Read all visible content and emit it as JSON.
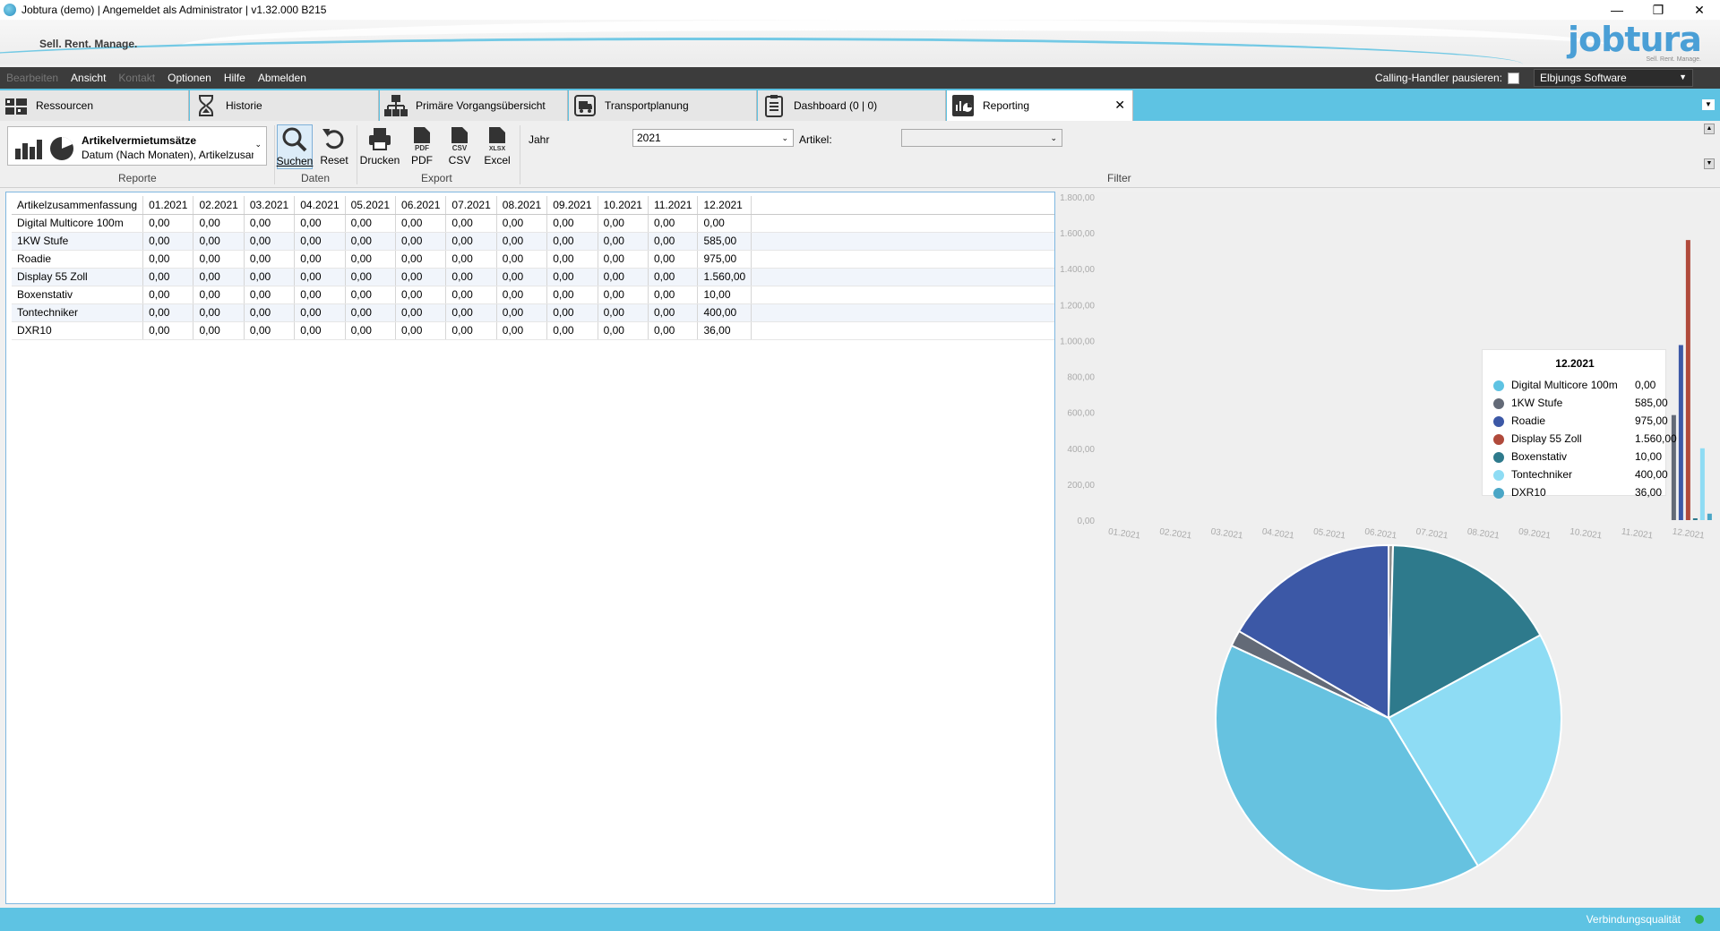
{
  "window": {
    "title": "Jobtura (demo) | Angemeldet als Administrator | v1.32.000 B215",
    "minimize": "—",
    "restore": "❐",
    "close": "✕"
  },
  "banner": {
    "tagline": "Sell. Rent. Manage.",
    "logo": "jobtura",
    "logo_sub": "Sell. Rent. Manage."
  },
  "menu": {
    "items": [
      "Bearbeiten",
      "Ansicht",
      "Kontakt",
      "Optionen",
      "Hilfe",
      "Abmelden"
    ],
    "disabled": [
      true,
      false,
      true,
      false,
      false,
      false
    ],
    "calling_handler_label": "Calling-Handler pausieren:",
    "company": "Elbjungs Software"
  },
  "tabs": [
    {
      "label": "Ressourcen",
      "icon": "resources-icon"
    },
    {
      "label": "Historie",
      "icon": "hourglass-icon"
    },
    {
      "label": "Primäre Vorgangsübersicht",
      "icon": "hierarchy-icon"
    },
    {
      "label": "Transportplanung",
      "icon": "truck-icon"
    },
    {
      "label": "Dashboard (0 | 0)",
      "icon": "clipboard-icon"
    },
    {
      "label": "Reporting",
      "icon": "reporting-icon",
      "active": true,
      "close": "✕"
    }
  ],
  "ribbon": {
    "report_title": "Artikelvermietumsätze",
    "report_sub": "Datum (Nach Monaten), Artikelzusammenfassung",
    "search": "Suchen",
    "reset": "Reset",
    "print": "Drucken",
    "pdf": "PDF",
    "csv": "CSV",
    "excel": "Excel",
    "group_reports": "Reporte",
    "group_data": "Daten",
    "group_export": "Export",
    "group_filter": "Filter",
    "year_label": "Jahr",
    "year_value": "2021",
    "article_label": "Artikel:",
    "article_value": ""
  },
  "table": {
    "headers": [
      "Artikelzusammenfassung",
      "01.2021",
      "02.2021",
      "03.2021",
      "04.2021",
      "05.2021",
      "06.2021",
      "07.2021",
      "08.2021",
      "09.2021",
      "10.2021",
      "11.2021",
      "12.2021"
    ],
    "rows": [
      [
        "Digital Multicore 100m",
        "0,00",
        "0,00",
        "0,00",
        "0,00",
        "0,00",
        "0,00",
        "0,00",
        "0,00",
        "0,00",
        "0,00",
        "0,00",
        "0,00"
      ],
      [
        "1KW Stufe",
        "0,00",
        "0,00",
        "0,00",
        "0,00",
        "0,00",
        "0,00",
        "0,00",
        "0,00",
        "0,00",
        "0,00",
        "0,00",
        "585,00"
      ],
      [
        "Roadie",
        "0,00",
        "0,00",
        "0,00",
        "0,00",
        "0,00",
        "0,00",
        "0,00",
        "0,00",
        "0,00",
        "0,00",
        "0,00",
        "975,00"
      ],
      [
        "Display 55 Zoll",
        "0,00",
        "0,00",
        "0,00",
        "0,00",
        "0,00",
        "0,00",
        "0,00",
        "0,00",
        "0,00",
        "0,00",
        "0,00",
        "1.560,00"
      ],
      [
        "Boxenstativ",
        "0,00",
        "0,00",
        "0,00",
        "0,00",
        "0,00",
        "0,00",
        "0,00",
        "0,00",
        "0,00",
        "0,00",
        "0,00",
        "10,00"
      ],
      [
        "Tontechniker",
        "0,00",
        "0,00",
        "0,00",
        "0,00",
        "0,00",
        "0,00",
        "0,00",
        "0,00",
        "0,00",
        "0,00",
        "0,00",
        "400,00"
      ],
      [
        "DXR10",
        "0,00",
        "0,00",
        "0,00",
        "0,00",
        "0,00",
        "0,00",
        "0,00",
        "0,00",
        "0,00",
        "0,00",
        "0,00",
        "36,00"
      ]
    ]
  },
  "tooltip": {
    "title": "12.2021",
    "rows": [
      {
        "name": "Digital Multicore 100m",
        "value": "0,00"
      },
      {
        "name": "1KW Stufe",
        "value": "585,00"
      },
      {
        "name": "Roadie",
        "value": "975,00"
      },
      {
        "name": "Display 55 Zoll",
        "value": "1.560,00"
      },
      {
        "name": "Boxenstativ",
        "value": "10,00"
      },
      {
        "name": "Tontechniker",
        "value": "400,00"
      },
      {
        "name": "DXR10",
        "value": "36,00"
      }
    ]
  },
  "chart_data": [
    {
      "type": "bar",
      "categories": [
        "01.2021",
        "02.2021",
        "03.2021",
        "04.2021",
        "05.2021",
        "06.2021",
        "07.2021",
        "08.2021",
        "09.2021",
        "10.2021",
        "11.2021",
        "12.2021"
      ],
      "y_ticks": [
        "0,00",
        "200,00",
        "400,00",
        "600,00",
        "800,00",
        "1.000,00",
        "1.200,00",
        "1.400,00",
        "1.600,00",
        "1.800,00"
      ],
      "ylim": [
        0,
        1800
      ],
      "series": [
        {
          "name": "Digital Multicore 100m",
          "color": "#5ec3e3",
          "values": [
            0,
            0,
            0,
            0,
            0,
            0,
            0,
            0,
            0,
            0,
            0,
            0
          ]
        },
        {
          "name": "1KW Stufe",
          "color": "#636a77",
          "values": [
            0,
            0,
            0,
            0,
            0,
            0,
            0,
            0,
            0,
            0,
            0,
            585
          ]
        },
        {
          "name": "Roadie",
          "color": "#3c58a6",
          "values": [
            0,
            0,
            0,
            0,
            0,
            0,
            0,
            0,
            0,
            0,
            0,
            975
          ]
        },
        {
          "name": "Display 55 Zoll",
          "color": "#b04a3b",
          "values": [
            0,
            0,
            0,
            0,
            0,
            0,
            0,
            0,
            0,
            0,
            0,
            1560
          ]
        },
        {
          "name": "Boxenstativ",
          "color": "#2e7a8c",
          "values": [
            0,
            0,
            0,
            0,
            0,
            0,
            0,
            0,
            0,
            0,
            0,
            10
          ]
        },
        {
          "name": "Tontechniker",
          "color": "#8edcf4",
          "values": [
            0,
            0,
            0,
            0,
            0,
            0,
            0,
            0,
            0,
            0,
            0,
            400
          ]
        },
        {
          "name": "DXR10",
          "color": "#4aa6c6",
          "values": [
            0,
            0,
            0,
            0,
            0,
            0,
            0,
            0,
            0,
            0,
            0,
            36
          ]
        }
      ]
    },
    {
      "type": "pie",
      "labels": [
        "Digital Multicore 100m",
        "1KW Stufe",
        "Roadie",
        "Display 55 Zoll",
        "Boxenstativ",
        "Tontechniker",
        "DXR10"
      ],
      "values": [
        0,
        585,
        975,
        1560,
        10,
        400,
        36
      ],
      "colors": [
        "#5ec3e3",
        "#636a77",
        "#3c58a6",
        "#b04a3b",
        "#2e7a8c",
        "#8edcf4",
        "#4aa6c6"
      ],
      "pie_values": [
        10,
        400,
        585,
        975,
        36,
        400,
        10
      ],
      "pie_colors": [
        "#8e8e8e",
        "#2e7a8c",
        "#8edcf4",
        "#66c2e0",
        "#636a77",
        "#3c58a6"
      ]
    }
  ],
  "status": {
    "connection_label": "Verbindungsqualität"
  }
}
